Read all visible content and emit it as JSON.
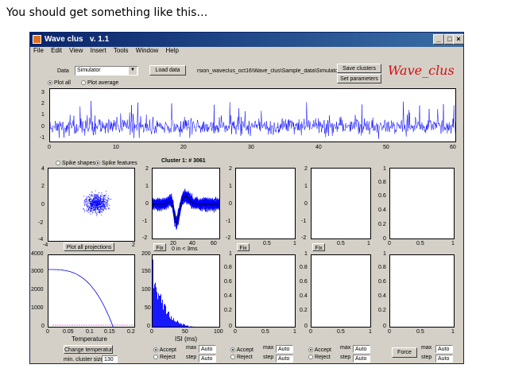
{
  "caption": "You should get something like this…",
  "window": {
    "title": "Wave clus",
    "version": "v. 1.1",
    "controls": [
      "_",
      "□",
      "×"
    ]
  },
  "menu": [
    "File",
    "Edit",
    "View",
    "Insert",
    "Tools",
    "Window",
    "Help"
  ],
  "toolbar": {
    "data_label": "Data",
    "data_select": "Simulator",
    "load_button": "Load data",
    "path": "rsion_waveclus_oct16\\Wave_clus\\Sample_data\\Simulator\\",
    "save_button": "Save clusters",
    "params_button": "Set parameters",
    "brand": "Wave_clus",
    "plot_all": "Plot all",
    "plot_average": "Plot average"
  },
  "colors": {
    "signal": "#0000ff",
    "titlebar": "#0a246a",
    "brand": "#d01010"
  },
  "signal_axes": {
    "y_ticks": [
      "3",
      "2",
      "1",
      "0",
      "-1"
    ],
    "x_ticks": [
      "0",
      "10",
      "20",
      "30",
      "40",
      "50",
      "60"
    ]
  },
  "row1": {
    "spike_shapes": "Spike shapes",
    "spike_features": "Spike features",
    "feature_y_ticks": [
      "4",
      "2",
      "0",
      "-2",
      "-4"
    ],
    "feature_x_ticks": [
      "-4",
      "2"
    ],
    "plot_projections": "Plot all projections",
    "cluster_title": "Cluster 1:  # 3061",
    "cluster_y_ticks": [
      "2",
      "1",
      "0",
      "-1",
      "-2"
    ],
    "cluster_x_ticks": [
      "20",
      "40",
      "60"
    ],
    "fix": "Fix",
    "isi_note": "0 in < 3ms",
    "empty_y_ticks": [
      "2",
      "1",
      "0",
      "-1",
      "-2"
    ],
    "empty_x_ticks": [
      "0",
      "0.5",
      "1"
    ],
    "last_y_ticks": [
      "1",
      "0.8",
      "0.6",
      "0.4",
      "0.2",
      "0"
    ]
  },
  "temperature": {
    "y_ticks": [
      "4000",
      "3000",
      "2000",
      "1000",
      "0"
    ],
    "x_ticks": [
      "0",
      "0.05",
      "0.1",
      "0.15",
      "0.2"
    ],
    "xlabel": "Temperature",
    "change_button": "Change temperature",
    "min_cluster_label": "min. cluster size",
    "min_cluster_value": "130"
  },
  "isi": {
    "y_ticks": [
      "200",
      "150",
      "100",
      "50",
      "0"
    ],
    "x_ticks": [
      "0",
      "50",
      "100"
    ],
    "xlabel": "ISI (ms)"
  },
  "empty_row2": {
    "y_ticks": [
      "1",
      "0.8",
      "0.6",
      "0.4",
      "0.2",
      "0"
    ],
    "x_ticks": [
      "0",
      "0.5",
      "1"
    ]
  },
  "cluster_controls": {
    "accept": "Accept",
    "reject": "Reject",
    "max": "max",
    "step": "step",
    "auto": "Auto",
    "force": "Force"
  }
}
